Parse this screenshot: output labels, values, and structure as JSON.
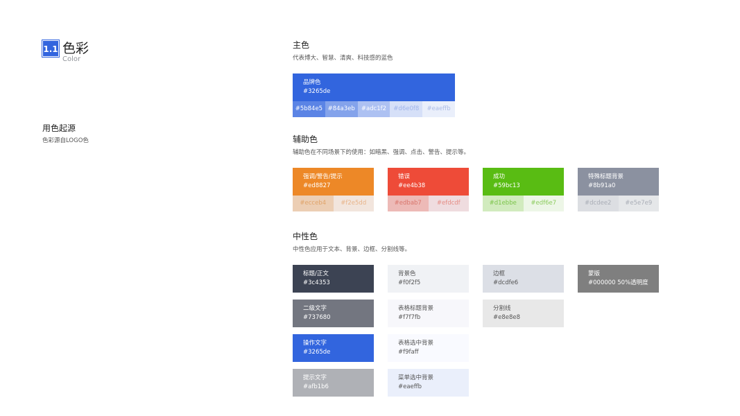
{
  "header": {
    "number": "1.1",
    "title": "色彩",
    "subtitle": "Color"
  },
  "origin": {
    "title": "用色起源",
    "desc": "色彩源自LOGO色"
  },
  "primary": {
    "title": "主色",
    "desc": "代表博大、智慧、清爽、科技感的蓝色",
    "main": {
      "name": "品牌色",
      "hex": "#3265de",
      "color": "#3265de",
      "text_color": "#ffffff"
    },
    "tints": [
      {
        "hex": "#5b84e5",
        "color": "#5b84e5",
        "text_color": "#ffffff"
      },
      {
        "hex": "#84a3eb",
        "color": "#84a3eb",
        "text_color": "#ffffff"
      },
      {
        "hex": "#adc1f2",
        "color": "#adc1f2",
        "text_color": "#ffffff"
      },
      {
        "hex": "#d6e0f8",
        "color": "#d6e0f8",
        "text_color": "#9fb4ea"
      },
      {
        "hex": "#eaeffb",
        "color": "#eaeffb",
        "text_color": "#adbde6"
      }
    ]
  },
  "auxiliary": {
    "title": "辅助色",
    "desc": "辅助色在不同场景下的使用：如暗黑、强调、点击、警告、提示等。",
    "groups": [
      {
        "name": "强调/警告/提示",
        "hex": "#ed8827",
        "color": "#ed8827",
        "text_color": "#ffffff",
        "tints": [
          {
            "hex": "#ecceb4",
            "color": "#ecceb4",
            "text_color": "#e0a46a"
          },
          {
            "hex": "#f2e5dd",
            "color": "#f2e5dd",
            "text_color": "#e8b48a"
          }
        ]
      },
      {
        "name": "错误",
        "hex": "#ee4b38",
        "color": "#ee4b38",
        "text_color": "#ffffff",
        "tints": [
          {
            "hex": "#edbab7",
            "color": "#edbab7",
            "text_color": "#d9766c"
          },
          {
            "hex": "#efdcdf",
            "color": "#efdcdf",
            "text_color": "#e58c84"
          }
        ]
      },
      {
        "name": "成功",
        "hex": "#59bc13",
        "color": "#59bc13",
        "text_color": "#ffffff",
        "tints": [
          {
            "hex": "#d1ebbe",
            "color": "#d1ebbe",
            "text_color": "#7cc44a"
          },
          {
            "hex": "#edf6e7",
            "color": "#edf6e7",
            "text_color": "#8ccc5e"
          }
        ]
      },
      {
        "name": "特殊标题背景",
        "hex": "#8b91a0",
        "color": "#8b91a0",
        "text_color": "#ffffff",
        "tints": [
          {
            "hex": "#dcdee2",
            "color": "#dcdee2",
            "text_color": "#a9adb6"
          },
          {
            "hex": "#e5e7e9",
            "color": "#e5e7e9",
            "text_color": "#a9adb6"
          }
        ]
      }
    ]
  },
  "neutral": {
    "title": "中性色",
    "desc": "中性色应用于文本、背景、边框、分割线等。",
    "columns": [
      [
        {
          "name": "标题/正文",
          "hex": "#3c4353",
          "color": "#3c4353",
          "text_color": "#ffffff"
        },
        {
          "name": "二级文字",
          "hex": "#737680",
          "color": "#737680",
          "text_color": "#ffffff"
        },
        {
          "name": "操作文字",
          "hex": "#3265de",
          "color": "#3265de",
          "text_color": "#ffffff"
        },
        {
          "name": "提示文字",
          "hex": "#afb1b6",
          "color": "#afb1b6",
          "text_color": "#ffffff"
        }
      ],
      [
        {
          "name": "背景色",
          "hex": "#f0f2f5",
          "color": "#f0f2f5",
          "text_color": "#555555"
        },
        {
          "name": "表格标题背景",
          "hex": "#f7f7fb",
          "color": "#f7f7fb",
          "text_color": "#555555"
        },
        {
          "name": "表格选中背景",
          "hex": "#f9faff",
          "color": "#f9faff",
          "text_color": "#555555"
        },
        {
          "name": "菜单选中背景",
          "hex": "#eaeffb",
          "color": "#eaeffb",
          "text_color": "#555555"
        }
      ],
      [
        {
          "name": "边框",
          "hex": "#dcdfe6",
          "color": "#dcdfe6",
          "text_color": "#555555"
        },
        {
          "name": "分割线",
          "hex": "#e8e8e8",
          "color": "#e8e8e8",
          "text_color": "#555555"
        }
      ],
      [
        {
          "name": "蒙版",
          "hex": "#000000 50%透明度",
          "color": "#7f7f7f",
          "text_color": "#ffffff"
        }
      ]
    ]
  }
}
